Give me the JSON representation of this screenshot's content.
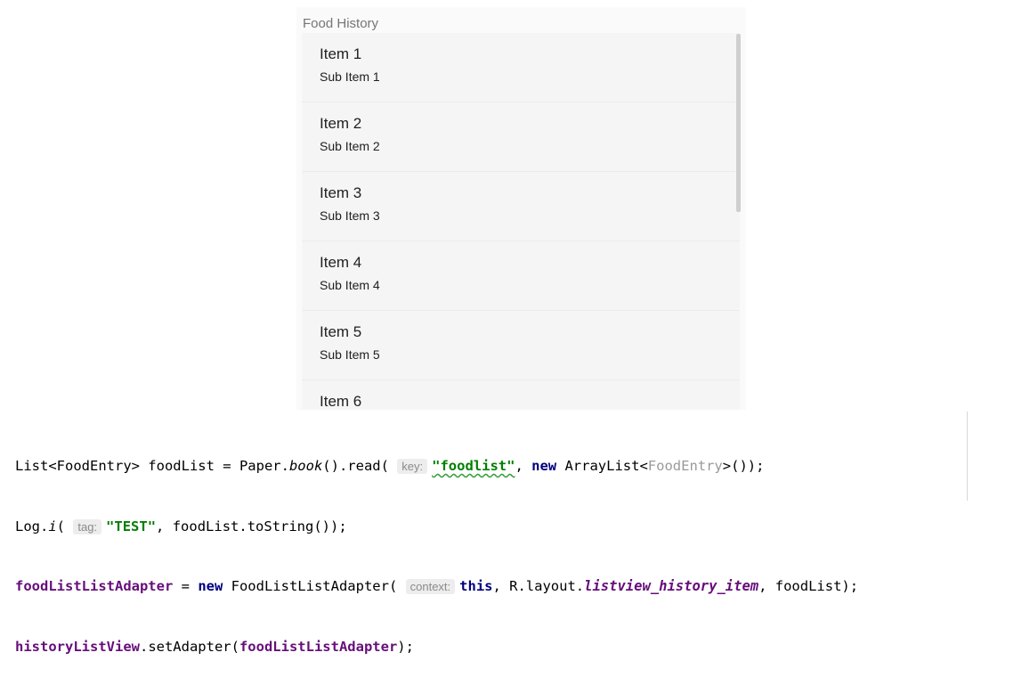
{
  "app": {
    "title": "Food History"
  },
  "list": {
    "items": [
      {
        "title": "Item 1",
        "subtitle": "Sub Item 1"
      },
      {
        "title": "Item 2",
        "subtitle": "Sub Item 2"
      },
      {
        "title": "Item 3",
        "subtitle": "Sub Item 3"
      },
      {
        "title": "Item 4",
        "subtitle": "Sub Item 4"
      },
      {
        "title": "Item 5",
        "subtitle": "Sub Item 5"
      },
      {
        "title": "Item 6",
        "subtitle": ""
      }
    ]
  },
  "code": {
    "line1": {
      "a": "List<FoodEntry> foodList = Paper.",
      "book": "book",
      "b": "().read(",
      "hint": "key:",
      "str": "\"foodlist\"",
      "c": ", ",
      "kw_new": "new",
      "d": " ArrayList<",
      "generic": "FoodEntry",
      "e": ">());"
    },
    "line2": {
      "a": "Log.",
      "method": "i",
      "b": "(",
      "hint": "tag:",
      "str": "\"TEST\"",
      "c": ", foodList.toString());"
    },
    "line3": {
      "field": "foodListListAdapter",
      "a": " = ",
      "kw_new": "new",
      "b": " FoodListListAdapter(",
      "hint": "context:",
      "kw_this": "this",
      "c": ", R.layout.",
      "layout": "listview_history_item",
      "d": ", foodList);"
    },
    "line4": {
      "field": "historyListView",
      "a": ".setAdapter(",
      "arg": "foodListListAdapter",
      "b": ");"
    }
  }
}
